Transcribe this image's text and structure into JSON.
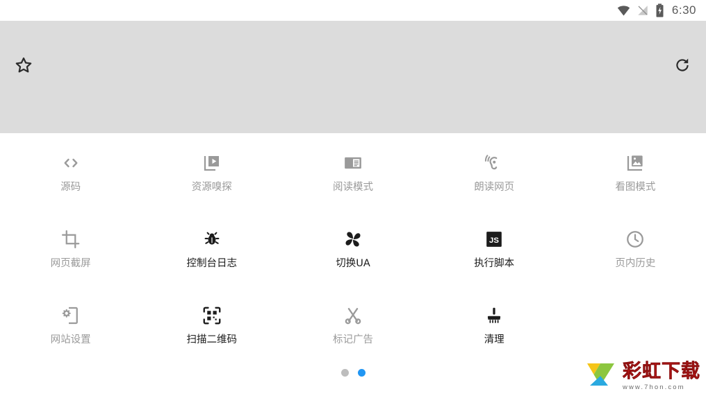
{
  "status_bar": {
    "icons": [
      "wifi-icon",
      "signal-off-icon",
      "battery-charging-icon"
    ],
    "time": "6:30"
  },
  "toolbar": {
    "bookmark_icon": "star-outline-icon",
    "refresh_icon": "refresh-icon",
    "background_color": "#dcdcdc"
  },
  "grid": {
    "items": [
      {
        "label": "源码",
        "icon": "code-brackets-icon",
        "state": "dim"
      },
      {
        "label": "资源嗅探",
        "icon": "media-play-icon",
        "state": "dim"
      },
      {
        "label": "阅读模式",
        "icon": "reading-mode-icon",
        "state": "dim"
      },
      {
        "label": "朗读网页",
        "icon": "ear-listen-icon",
        "state": "dim"
      },
      {
        "label": "看图模式",
        "icon": "image-photo-icon",
        "state": "dim"
      },
      {
        "label": "网页截屏",
        "icon": "crop-icon",
        "state": "dim"
      },
      {
        "label": "控制台日志",
        "icon": "bug-icon",
        "state": "dark"
      },
      {
        "label": "切换UA",
        "icon": "pinwheel-icon",
        "state": "dark"
      },
      {
        "label": "执行脚本",
        "icon": "js-badge-icon",
        "state": "dark"
      },
      {
        "label": "页内历史",
        "icon": "clock-icon",
        "state": "dim"
      },
      {
        "label": "网站设置",
        "icon": "phone-gear-icon",
        "state": "dim"
      },
      {
        "label": "扫描二维码",
        "icon": "qr-scan-icon",
        "state": "dark"
      },
      {
        "label": "标记广告",
        "icon": "scissors-icon",
        "state": "dim"
      },
      {
        "label": "清理",
        "icon": "brush-icon",
        "state": "dark"
      },
      {
        "label": "",
        "icon": "",
        "state": "empty"
      }
    ]
  },
  "pagination": {
    "total": 2,
    "current": 2,
    "active_color": "#2196f3",
    "inactive_color": "#bdbdbd"
  },
  "watermark": {
    "title": "彩虹下载",
    "url": "www.7hon.com"
  }
}
